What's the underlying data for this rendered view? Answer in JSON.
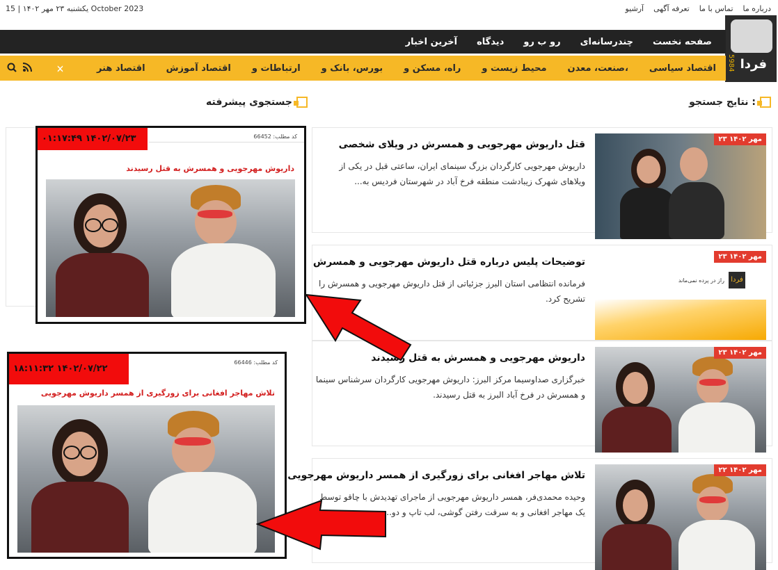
{
  "topbar": {
    "date": "یکشنبه ۲۳ مهر ۱۴۰۲ | 15 October 2023",
    "links": [
      "درباره ما",
      "تماس با ما",
      "تعرفه آگهی",
      "آرشیو"
    ]
  },
  "logo": {
    "mid_text": "فردا",
    "small_text": "5984"
  },
  "dark_nav": [
    "صفحه نخست",
    "چندرسانه‌ای",
    "رو ب رو",
    "دیدگاه",
    "آخرین اخبار"
  ],
  "yellow_nav": [
    "اقتصاد سیاسی",
    "صنعت، معدن،",
    "محیط زیست و",
    "راه، مسکن و",
    "بورس، بانک و",
    "ارتباطات و",
    "اقتصاد آموزش",
    "اقتصاد هنر"
  ],
  "icons": {
    "search": "search-icon",
    "rss": "rss-icon",
    "prev": "chevron-left-icon",
    "next": "chevron-right-icon"
  },
  "sections": {
    "results_title": "نتایج جستجو :",
    "advanced_title": "جستجوی پیشرفته"
  },
  "results": [
    {
      "date": "۲۳ مهر ۱۴۰۲",
      "title": "قتل داریوش مهرجویی و همسرش در ویلای شخصی",
      "desc": "داریوش مهرجویی کارگردان بزرگ سینمای ایران، ساعتی قبل در یکی از ویلاهای شهرک زیبادشت منطقه فرخ آباد در شهرستان فردیس به..."
    },
    {
      "date": "۲۳ مهر ۱۴۰۲",
      "title": "توضیحات پلیس درباره قتل داریوش مهرجویی و همسرش",
      "desc": "فرمانده انتظامی استان البرز جزئیاتی از قتل داریوش مهرجویی و همسرش را تشریح کرد."
    },
    {
      "date": "۲۳ مهر ۱۴۰۲",
      "title": "داریوش مهرجویی و همسرش به قتل رسیدند",
      "desc": "خبرگزاری صداوسیما مرکز البرز: داریوش مهرجویی کارگردان سرشناس سینما و همسرش در فرخ آباد البرز به قتل رسیدند."
    },
    {
      "date": "۲۲ مهر ۱۴۰۲",
      "title": "تلاش مهاجر افغانی برای زورگیری از همسر داریوش مهرجویی",
      "desc": "وحیده محمدی‌فر، همسر داریوش مهرجویی از ماجرای تهدیدش با چاقو توسط یک مهاجر افغانی و به سرقت رفتن گوشی، لب تاپ و دو..."
    }
  ],
  "farda_thumb": {
    "logo": "فردا",
    "tagline": "راز در پرده نمی‌ماند"
  },
  "shots": [
    {
      "stamp": "۰۱:۱۷:۴۹ ۱۴۰۲/۰۷/۲۳",
      "code": "کد مطلب: 66452",
      "headline": "داریوش مهرجویی و همسرش به قتل رسیدند"
    },
    {
      "stamp": "۱۸:۱۱:۳۲ ۱۴۰۲/۰۷/۲۲",
      "code": "کد مطلب: 66446",
      "headline": "تلاش مهاجر افغانی برای زورگیری از همسر داریوش مهرجویی"
    }
  ],
  "colors": {
    "accent": "#f6b826",
    "dark": "#232323",
    "red": "#f20c0c",
    "date_badge": "#e23b2e"
  }
}
